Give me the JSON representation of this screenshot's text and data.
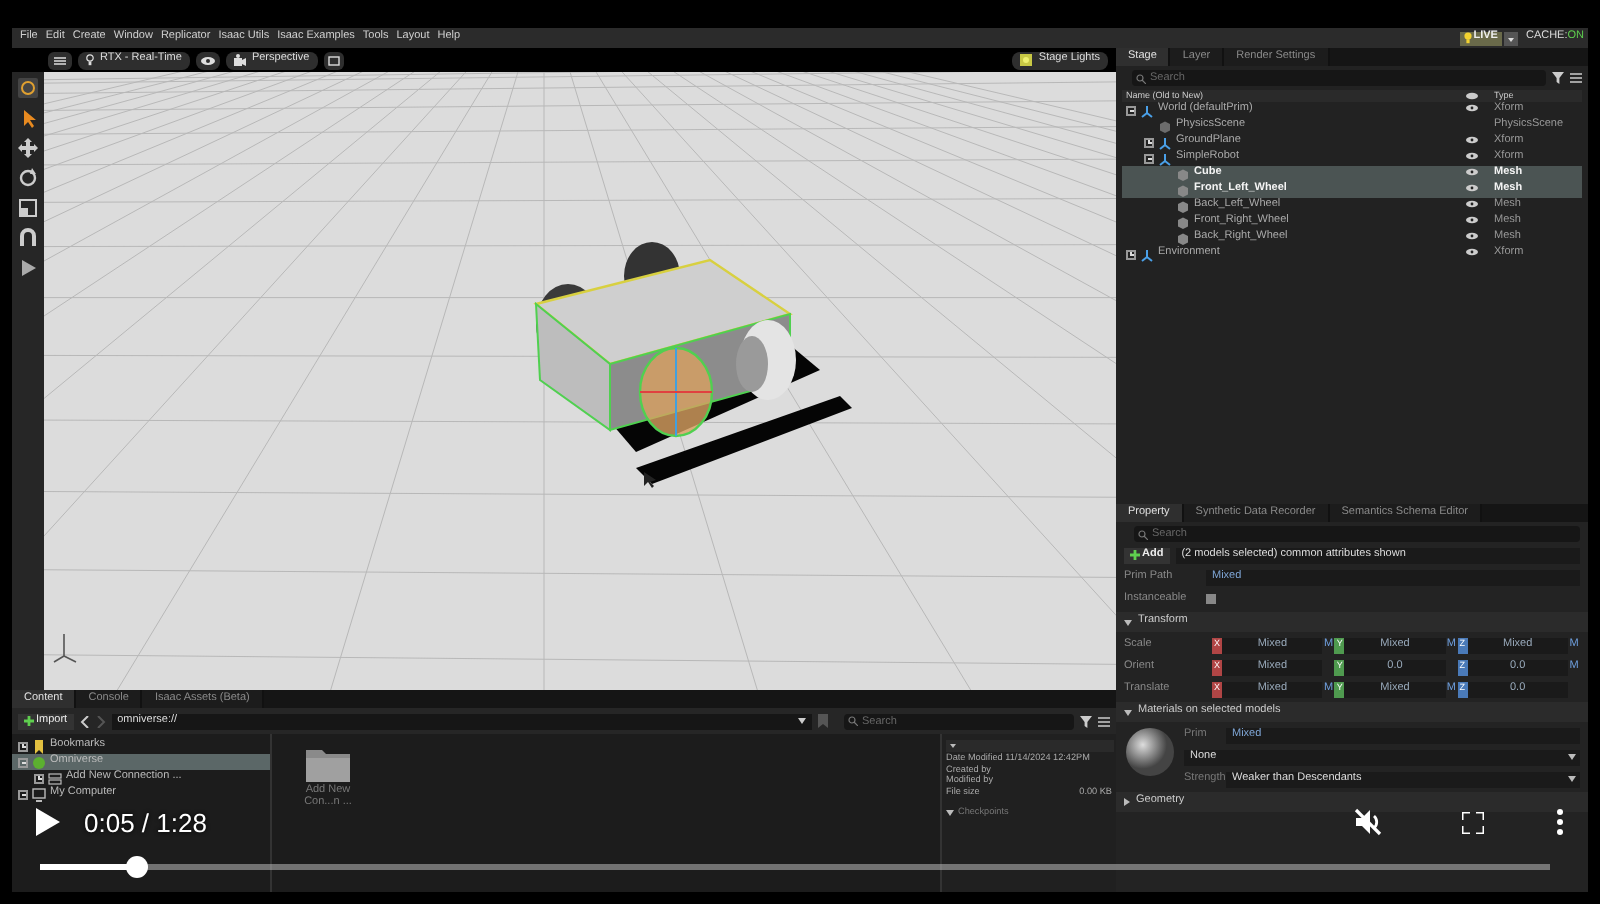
{
  "menu": [
    "File",
    "Edit",
    "Create",
    "Window",
    "Replicator",
    "Isaac Utils",
    "Isaac Examples",
    "Tools",
    "Layout",
    "Help"
  ],
  "status": {
    "live": "LIVE",
    "cache_label": "CACHE:",
    "cache_value": "ON"
  },
  "viewport": {
    "render_mode": "RTX - Real-Time",
    "camera": "Perspective",
    "lights": "Stage Lights"
  },
  "stage": {
    "tabs": [
      {
        "label": "Stage",
        "selected": true
      },
      {
        "label": "Layer",
        "selected": false
      },
      {
        "label": "Render Settings",
        "selected": false
      }
    ],
    "search": {
      "placeholder": "Search"
    },
    "columns": [
      "Name (Old to New)",
      "Type"
    ],
    "tree": [
      {
        "name": "World (defaultPrim)",
        "type": "Xform",
        "kind": "xform",
        "visible": true,
        "selected": false,
        "expanded": true,
        "children": [
          {
            "name": "PhysicsScene",
            "type": "PhysicsScene",
            "kind": "scene",
            "visible": false,
            "selected": false
          },
          {
            "name": "GroundPlane",
            "type": "Xform",
            "kind": "xform",
            "visible": true,
            "selected": false,
            "expanded": false
          },
          {
            "name": "SimpleRobot",
            "type": "Xform",
            "kind": "xform",
            "visible": true,
            "selected": false,
            "expanded": true,
            "children": [
              {
                "name": "Cube",
                "type": "Mesh",
                "kind": "mesh",
                "visible": true,
                "selected": true
              },
              {
                "name": "Front_Left_Wheel",
                "type": "Mesh",
                "kind": "mesh",
                "visible": true,
                "selected": true
              },
              {
                "name": "Back_Left_Wheel",
                "type": "Mesh",
                "kind": "mesh",
                "visible": true,
                "selected": false
              },
              {
                "name": "Front_Right_Wheel",
                "type": "Mesh",
                "kind": "mesh",
                "visible": true,
                "selected": false
              },
              {
                "name": "Back_Right_Wheel",
                "type": "Mesh",
                "kind": "mesh",
                "visible": true,
                "selected": false
              }
            ]
          }
        ]
      },
      {
        "name": "Environment",
        "type": "Xform",
        "kind": "xform",
        "visible": true,
        "selected": false,
        "expanded": false
      }
    ]
  },
  "property": {
    "tabs": [
      {
        "label": "Property",
        "selected": true
      },
      {
        "label": "Synthetic Data Recorder",
        "selected": false
      },
      {
        "label": "Semantics Schema Editor",
        "selected": false
      }
    ],
    "search": {
      "placeholder": "Search"
    },
    "add_button": "Add",
    "selection_note": "(2 models selected) common attributes shown",
    "prim_path": {
      "label": "Prim Path",
      "value": "Mixed"
    },
    "instanceable": {
      "label": "Instanceable",
      "checked": false
    },
    "sections": [
      {
        "kind": "transform",
        "title": "Transform",
        "expanded": true,
        "rows": [
          {
            "label": "Scale",
            "fields": [
              {
                "axis": "X",
                "value": "Mixed",
                "marker": "M"
              },
              {
                "axis": "Y",
                "value": "Mixed",
                "marker": "M"
              },
              {
                "axis": "Z",
                "value": "Mixed",
                "marker": "M"
              }
            ]
          },
          {
            "label": "Orient",
            "fields": [
              {
                "axis": "X",
                "value": "Mixed"
              },
              {
                "axis": "Y",
                "value": "0.0"
              },
              {
                "axis": "Z",
                "value": "0.0",
                "marker": "M"
              }
            ]
          },
          {
            "label": "Translate",
            "fields": [
              {
                "axis": "X",
                "value": "Mixed",
                "marker": "M"
              },
              {
                "axis": "Y",
                "value": "Mixed",
                "marker": "M"
              },
              {
                "axis": "Z",
                "value": "0.0"
              }
            ]
          }
        ]
      },
      {
        "kind": "material",
        "title": "Materials on selected models",
        "expanded": true,
        "prim_label": "Prim",
        "prim_value": "Mixed",
        "material": "None",
        "strength_label": "Strength",
        "strength": "Weaker than Descendants"
      },
      {
        "kind": "collapsed",
        "title": "Geometry",
        "expanded": false
      }
    ]
  },
  "content": {
    "tabs": [
      {
        "label": "Content",
        "selected": true
      },
      {
        "label": "Console",
        "selected": false
      },
      {
        "label": "Isaac Assets (Beta)",
        "selected": false
      }
    ],
    "import_button": "Import",
    "path": "omniverse://",
    "search": {
      "placeholder": "Search"
    },
    "tree": [
      {
        "name": "Bookmarks",
        "kind": "bookmark",
        "expanded": false,
        "selected": false
      },
      {
        "name": "Omniverse",
        "kind": "cloud",
        "expanded": true,
        "selected": true,
        "children": [
          {
            "name": "Add New Connection ...",
            "kind": "connection",
            "expanded": false,
            "selected": false
          }
        ]
      },
      {
        "name": "My Computer",
        "kind": "computer",
        "expanded": true,
        "selected": false
      }
    ],
    "items": [
      {
        "label": "Add New Con...n ..."
      }
    ],
    "info": {
      "date_modified": "Date Modified 11/14/2024 12:42PM",
      "created_by": "Created by",
      "modified_by": "Modified by",
      "file_size_label": "File size",
      "file_size": "0.00 KB",
      "checkpoints": "Checkpoints"
    }
  },
  "video": {
    "time": "0:05 / 1:28",
    "level": 0.064,
    "muted": true
  }
}
